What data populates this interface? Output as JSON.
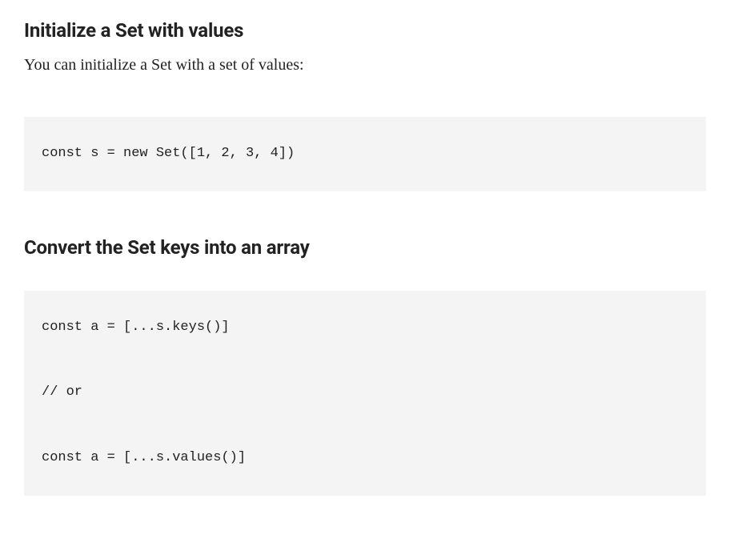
{
  "sections": {
    "initialize": {
      "heading": "Initialize a Set with values",
      "description": "You can initialize a Set with a set of values:",
      "code": "const s = new Set([1, 2, 3, 4])"
    },
    "convert": {
      "heading": "Convert the Set keys into an array",
      "code": "const a = [...s.keys()]\n\n// or\n\nconst a = [...s.values()]"
    }
  }
}
